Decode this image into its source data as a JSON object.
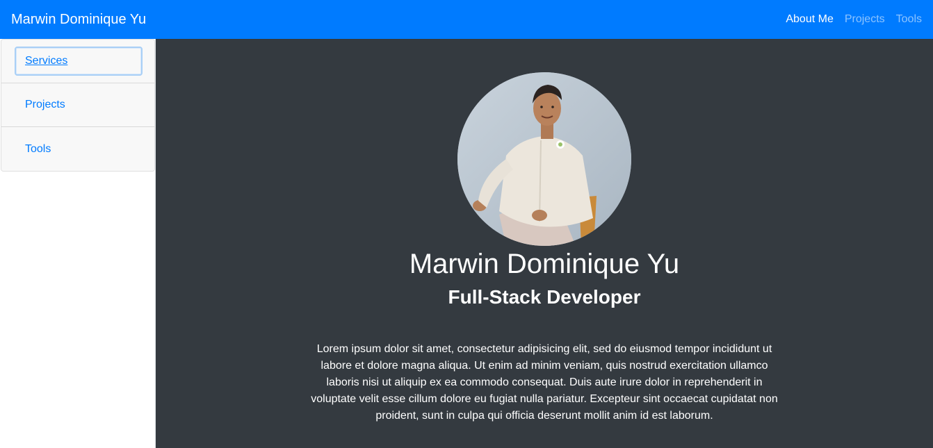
{
  "navbar": {
    "brand": "Marwin Dominique Yu",
    "links": [
      "About Me",
      "Projects",
      "Tools"
    ],
    "active_index": 0
  },
  "sidebar": {
    "items": [
      {
        "label": "Services",
        "focused": true
      },
      {
        "label": "Projects",
        "focused": false
      },
      {
        "label": "Tools",
        "focused": false
      }
    ]
  },
  "profile": {
    "name": "Marwin Dominique Yu",
    "role": "Full-Stack Developer",
    "bio": "Lorem ipsum dolor sit amet, consectetur adipisicing elit, sed do eiusmod tempor incididunt ut labore et dolore magna aliqua. Ut enim ad minim veniam, quis nostrud exercitation ullamco laboris nisi ut aliquip ex ea commodo consequat. Duis aute irure dolor in reprehenderit in voluptate velit esse cillum dolore eu fugiat nulla pariatur. Excepteur sint occaecat cupidatat non proident, sunt in culpa qui officia deserunt mollit anim id est laborum.",
    "photo_icon": "profile-photo"
  },
  "colors": {
    "navbar": "#007bff",
    "main_bg": "#343a40",
    "link": "#007bff"
  }
}
